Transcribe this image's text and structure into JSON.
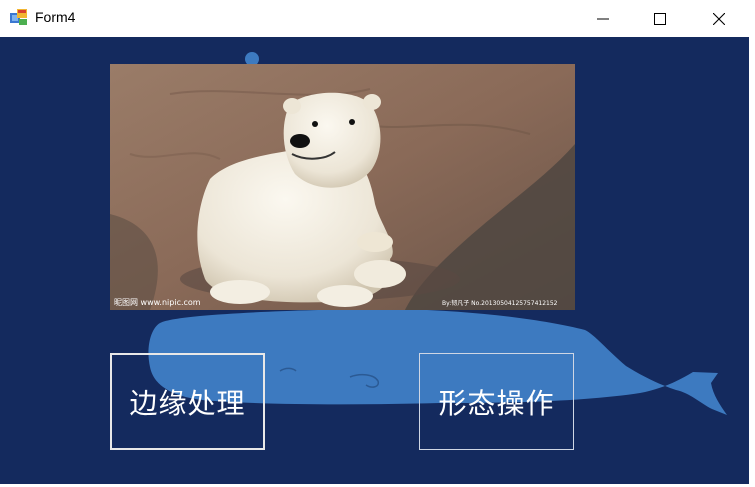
{
  "window": {
    "title": "Form4",
    "app_icon": "winforms-app-icon",
    "controls": {
      "minimize": "minimize-icon",
      "maximize": "maximize-icon",
      "close": "close-icon"
    }
  },
  "colors": {
    "client_background": "#142a5e",
    "whale_blue": "#3d7ac0",
    "button_border": "#e8e8e8",
    "button_text": "#ffffff"
  },
  "picture": {
    "subject": "polar-bear-image",
    "watermark_left": "昵图网 www.nipic.com",
    "watermark_right": "By:韧凡子 No.20130504125757412152"
  },
  "buttons": {
    "edge_processing": "边缘处理",
    "morphology": "形态操作"
  }
}
